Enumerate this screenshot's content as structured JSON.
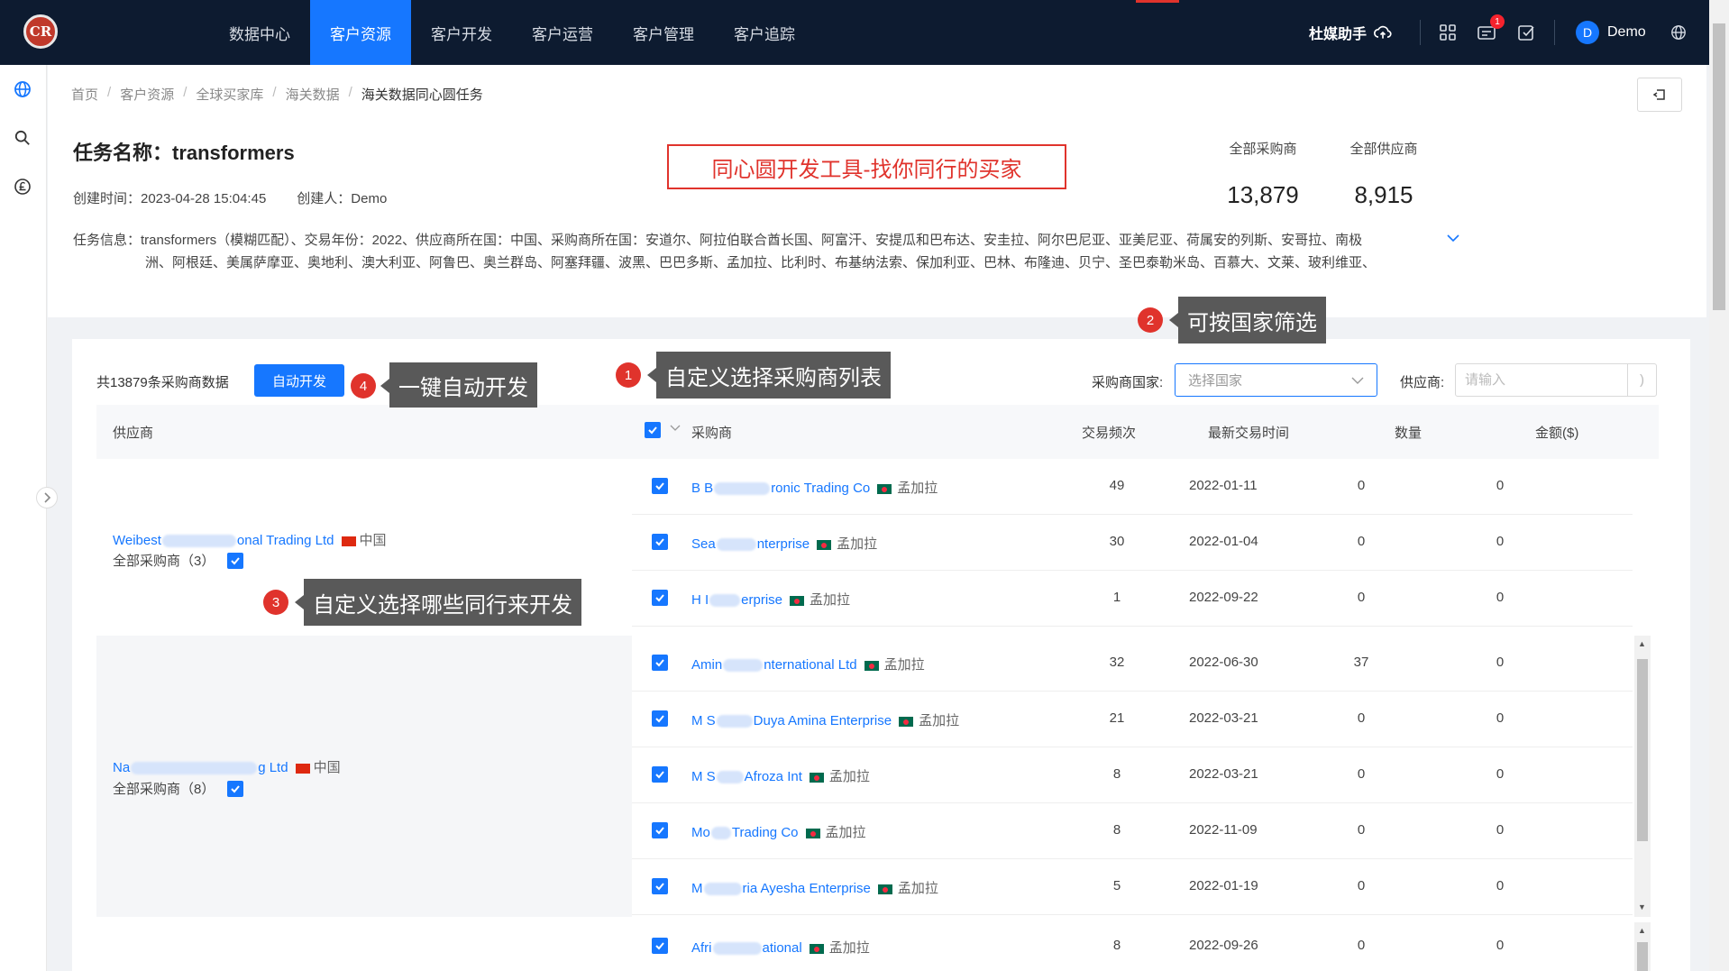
{
  "nav": {
    "logo_text": "CR",
    "items": [
      {
        "label": "数据中心"
      },
      {
        "label": "客户资源"
      },
      {
        "label": "客户开发"
      },
      {
        "label": "客户运营"
      },
      {
        "label": "客户管理"
      },
      {
        "label": "客户追踪"
      }
    ],
    "active_index": 1,
    "helper_label": "杜媒助手",
    "notification_count": "1",
    "user_initial": "D",
    "user_name": "Demo"
  },
  "breadcrumb": [
    "首页",
    "客户资源",
    "全球买家库",
    "海关数据",
    "海关数据同心圆任务"
  ],
  "task": {
    "title": "任务名称：transformers",
    "created_time": "创建时间：2023-04-28 15:04:45",
    "creator": "创建人：Demo",
    "info_line1": "任务信息：transformers（模糊匹配）、交易年份：2022、供应商所在国：中国、采购商所在国：安道尔、阿拉伯联合酋长国、阿富汗、安提瓜和巴布达、安圭拉、阿尔巴尼亚、亚美尼亚、荷属安的列斯、安哥拉、南极",
    "info_line2": "洲、阿根廷、美属萨摩亚、奥地利、澳大利亚、阿鲁巴、奥兰群岛、阿塞拜疆、波黑、巴巴多斯、孟加拉、比利时、布基纳法索、保加利亚、巴林、布隆迪、贝宁、圣巴泰勒米岛、百慕大、文莱、玻利维亚、",
    "promo_box": "同心圆开发工具-找你同行的买家"
  },
  "stats": [
    {
      "label": "全部采购商",
      "value": "13,879"
    },
    {
      "label": "全部供应商",
      "value": "8,915"
    }
  ],
  "toolbar": {
    "total": "共13879条采购商数据",
    "auto_button": "自动开发",
    "country_label": "采购商国家:",
    "country_placeholder": "选择国家",
    "supplier_label": "供应商:",
    "supplier_placeholder": "请输入"
  },
  "table": {
    "headers": {
      "supplier": "供应商",
      "buyer": "采购商",
      "frequency": "交易频次",
      "latest": "最新交易时间",
      "quantity": "数量",
      "amount": "金额($)"
    },
    "groups": [
      {
        "supplier_prefix": "Weibest",
        "supplier_suffix": "onal Trading Ltd",
        "supplier_country": "中国",
        "all_buyers": "全部采购商（3）",
        "rows": [
          {
            "buyer_prefix": "B B",
            "buyer_suffix": "ronic Trading Co",
            "country": "孟加拉",
            "frequency": "49",
            "date": "2022-01-11",
            "quantity": "0",
            "amount": "0"
          },
          {
            "buyer_prefix": "Sea",
            "buyer_suffix": "nterprise",
            "country": "孟加拉",
            "frequency": "30",
            "date": "2022-01-04",
            "quantity": "0",
            "amount": "0"
          },
          {
            "buyer_prefix": "H I",
            "buyer_suffix": "erprise",
            "country": "孟加拉",
            "frequency": "1",
            "date": "2022-09-22",
            "quantity": "0",
            "amount": "0"
          }
        ]
      },
      {
        "supplier_prefix": "Na",
        "supplier_suffix": "g Ltd",
        "supplier_country": "中国",
        "all_buyers": "全部采购商（8）",
        "rows": [
          {
            "buyer_prefix": "Amin",
            "buyer_suffix": "nternational Ltd",
            "country": "孟加拉",
            "frequency": "32",
            "date": "2022-06-30",
            "quantity": "37",
            "amount": "0"
          },
          {
            "buyer_prefix": "M S",
            "buyer_suffix": "Duya Amina Enterprise",
            "country": "孟加拉",
            "frequency": "21",
            "date": "2022-03-21",
            "quantity": "0",
            "amount": "0"
          },
          {
            "buyer_prefix": "M S",
            "buyer_suffix": "Afroza Int",
            "country": "孟加拉",
            "frequency": "8",
            "date": "2022-03-21",
            "quantity": "0",
            "amount": "0"
          },
          {
            "buyer_prefix": "Mo",
            "buyer_suffix": "Trading Co",
            "country": "孟加拉",
            "frequency": "8",
            "date": "2022-11-09",
            "quantity": "0",
            "amount": "0"
          },
          {
            "buyer_prefix": "M",
            "buyer_suffix": "ria Ayesha Enterprise",
            "country": "孟加拉",
            "frequency": "5",
            "date": "2022-01-19",
            "quantity": "0",
            "amount": "0"
          }
        ]
      },
      {
        "rows": [
          {
            "buyer_prefix": "Afri",
            "buyer_suffix": "ational",
            "country": "孟加拉",
            "frequency": "8",
            "date": "2022-09-26",
            "quantity": "0",
            "amount": "0"
          }
        ]
      }
    ]
  },
  "annotations": [
    {
      "num": "1",
      "text": "自定义选择采购商列表"
    },
    {
      "num": "2",
      "text": "可按国家筛选"
    },
    {
      "num": "3",
      "text": "自定义选择哪些同行来开发"
    },
    {
      "num": "4",
      "text": "一键自动开发"
    }
  ]
}
